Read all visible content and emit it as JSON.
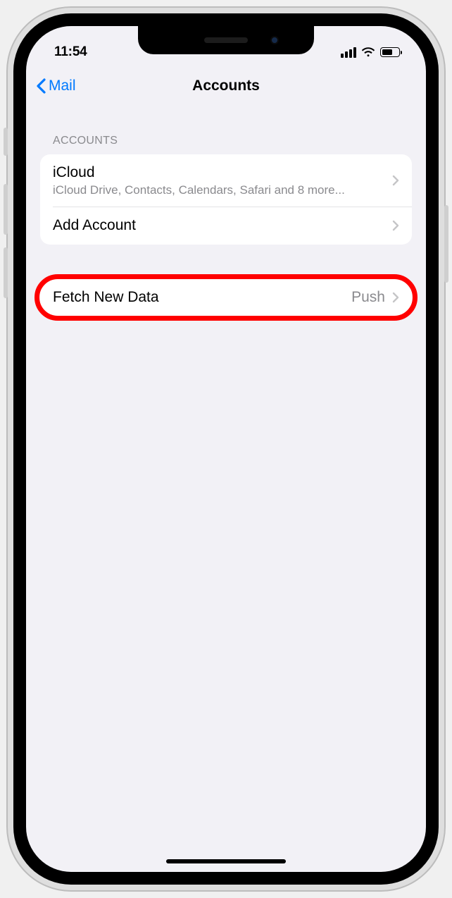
{
  "status": {
    "time": "11:54"
  },
  "nav": {
    "back_label": "Mail",
    "title": "Accounts"
  },
  "sections": {
    "accounts_header": "Accounts",
    "icloud": {
      "title": "iCloud",
      "subtitle": "iCloud Drive, Contacts, Calendars, Safari and 8 more..."
    },
    "add_account_label": "Add Account",
    "fetch": {
      "title": "Fetch New Data",
      "value": "Push"
    }
  }
}
